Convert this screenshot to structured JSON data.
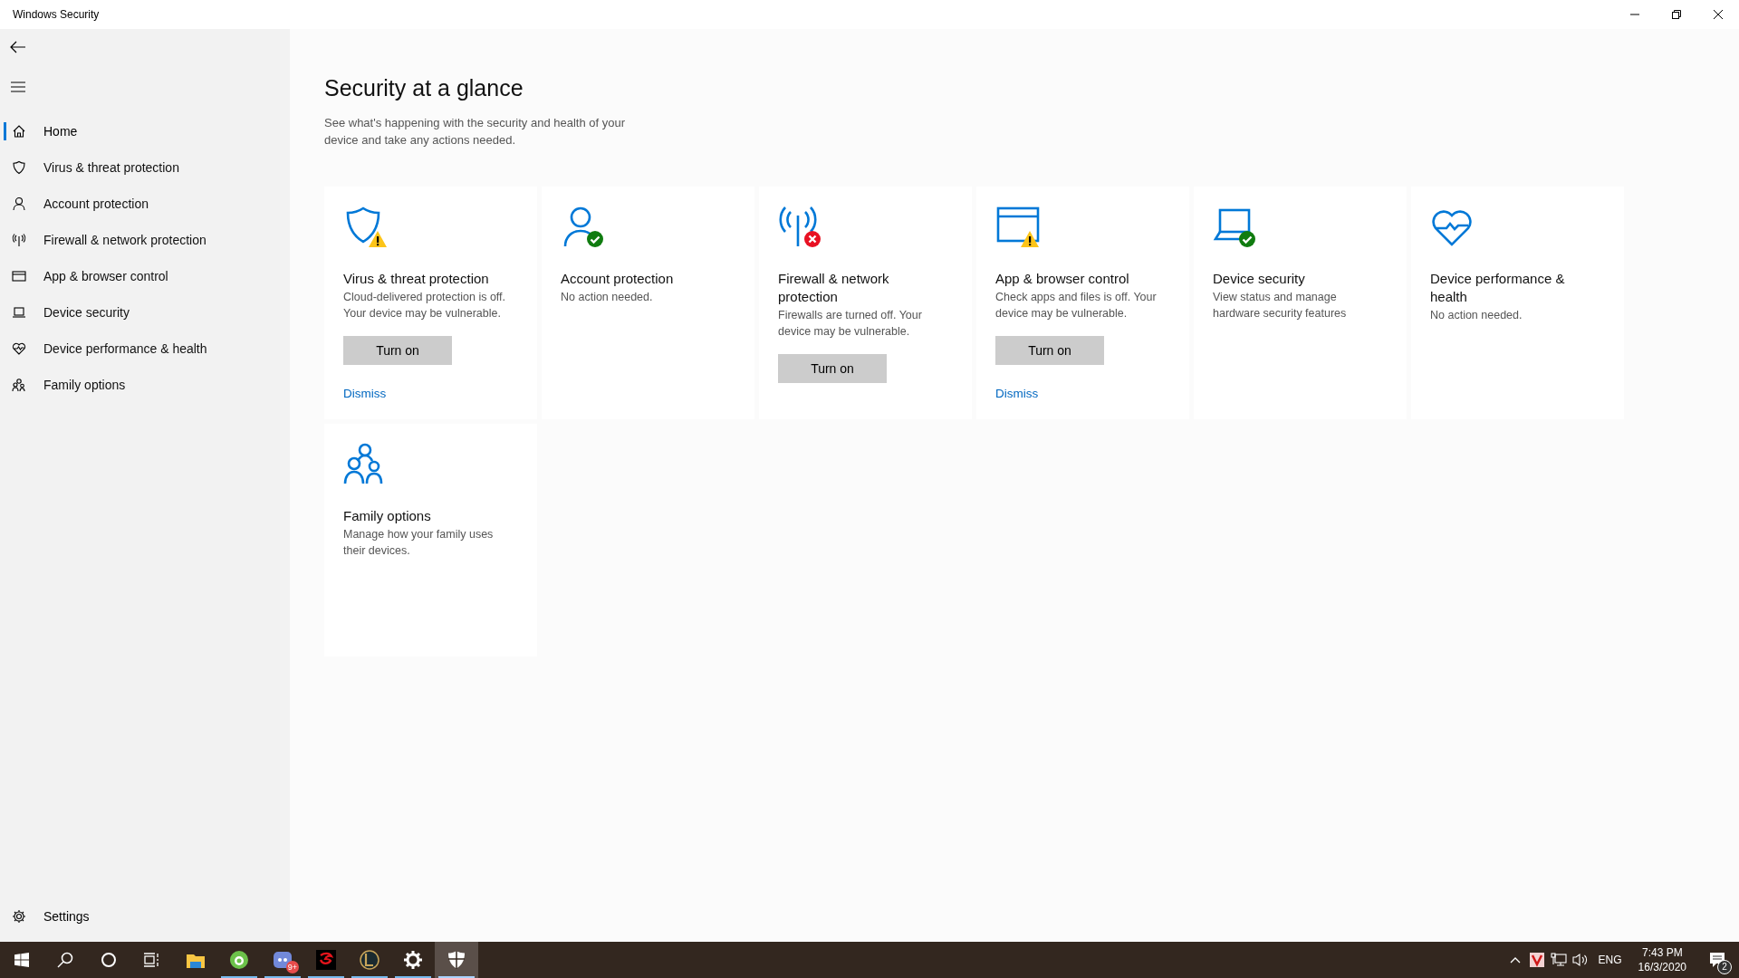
{
  "window": {
    "title": "Windows Security"
  },
  "sidebar": {
    "items": [
      {
        "label": "Home",
        "selected": true
      },
      {
        "label": "Virus & threat protection",
        "selected": false
      },
      {
        "label": "Account protection",
        "selected": false
      },
      {
        "label": "Firewall & network protection",
        "selected": false
      },
      {
        "label": "App & browser control",
        "selected": false
      },
      {
        "label": "Device security",
        "selected": false
      },
      {
        "label": "Device performance & health",
        "selected": false
      },
      {
        "label": "Family options",
        "selected": false
      }
    ],
    "footer": {
      "label": "Settings"
    }
  },
  "main": {
    "heading": "Security at a glance",
    "description": "See what's happening with the security and health of your device and take any actions needed.",
    "cards": [
      {
        "kind": "warning",
        "title": "Virus & threat protection",
        "description": "Cloud-delivered protection is off. Your device may be vulnerable.",
        "button": "Turn on",
        "link": "Dismiss"
      },
      {
        "kind": "ok",
        "title": "Account protection",
        "description": "No action needed."
      },
      {
        "kind": "error",
        "title": "Firewall & network protection",
        "description": "Firewalls are turned off. Your device may be vulnerable.",
        "button": "Turn on"
      },
      {
        "kind": "warning",
        "title": "App & browser control",
        "description": "Check apps and files is off. Your device may be vulnerable.",
        "button": "Turn on",
        "link": "Dismiss"
      },
      {
        "kind": "ok",
        "title": "Device security",
        "description": "View status and manage hardware security features"
      },
      {
        "kind": "plain",
        "title": "Device performance & health",
        "description": "No action needed."
      },
      {
        "kind": "plain",
        "title": "Family options",
        "description": "Manage how your family uses their devices."
      }
    ]
  },
  "taskbar": {
    "apps": [
      {
        "running": false,
        "selected": false
      },
      {
        "running": true,
        "selected": false
      },
      {
        "running": true,
        "selected": false,
        "badge": "9+"
      },
      {
        "running": true,
        "selected": false
      },
      {
        "running": true,
        "selected": false
      },
      {
        "running": true,
        "selected": false
      },
      {
        "running": true,
        "selected": true
      }
    ],
    "tray": {
      "language": "ENG",
      "time": "7:43 PM",
      "date": "16/3/2020",
      "notifications": "2"
    }
  }
}
